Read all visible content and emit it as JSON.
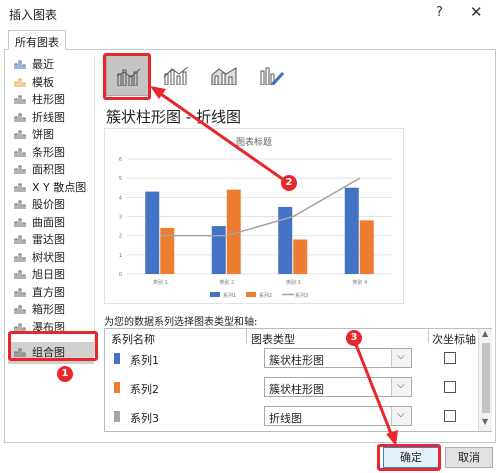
{
  "dialog": {
    "title": "插入图表",
    "help": "?",
    "close": "✕",
    "tab_all": "所有图表"
  },
  "chart_types": [
    {
      "label": "最近",
      "icon": "recent-icon"
    },
    {
      "label": "模板",
      "icon": "template-folder-icon"
    },
    {
      "label": "柱形图",
      "icon": "column-chart-icon"
    },
    {
      "label": "折线图",
      "icon": "line-chart-icon"
    },
    {
      "label": "饼图",
      "icon": "pie-chart-icon"
    },
    {
      "label": "条形图",
      "icon": "bar-chart-icon"
    },
    {
      "label": "面积图",
      "icon": "area-chart-icon"
    },
    {
      "label": "X Y 散点图",
      "icon": "scatter-chart-icon"
    },
    {
      "label": "股价图",
      "icon": "stock-chart-icon"
    },
    {
      "label": "曲面图",
      "icon": "surface-chart-icon"
    },
    {
      "label": "雷达图",
      "icon": "radar-chart-icon"
    },
    {
      "label": "树状图",
      "icon": "treemap-icon"
    },
    {
      "label": "旭日图",
      "icon": "sunburst-icon"
    },
    {
      "label": "直方图",
      "icon": "histogram-icon"
    },
    {
      "label": "箱形图",
      "icon": "box-whisker-icon"
    },
    {
      "label": "瀑布图",
      "icon": "waterfall-icon"
    },
    {
      "label": "组合图",
      "icon": "combo-chart-icon"
    }
  ],
  "selected_type": "组合图",
  "heading": "簇状柱形图 - 折线图",
  "series_caption": "为您的数据系列选择图表类型和轴:",
  "table_headers": {
    "name": "系列名称",
    "type": "图表类型",
    "secondary": "次坐标轴"
  },
  "series_rows": [
    {
      "name": "系列1",
      "type": "簇状柱形图",
      "color": "#4472c4",
      "secondary": false
    },
    {
      "name": "系列2",
      "type": "簇状柱形图",
      "color": "#ed7d31",
      "secondary": false
    },
    {
      "name": "系列3",
      "type": "折线图",
      "color": "#a5a5a5",
      "secondary": false
    }
  ],
  "buttons": {
    "ok": "确定",
    "cancel": "取消"
  },
  "badges": {
    "one": "1",
    "two": "2",
    "three": "3"
  },
  "colors": {
    "accent_red": "#e8262b",
    "series1": "#4472c4",
    "series2": "#ed7d31",
    "series3": "#a5a5a5"
  },
  "chart_data": {
    "type": "bar",
    "title": "图表标题",
    "categories": [
      "类别 1",
      "类别 2",
      "类别 3",
      "类别 4"
    ],
    "ylim": [
      0,
      6
    ],
    "yticks": [
      "0",
      "1",
      "2",
      "3",
      "4",
      "5",
      "6"
    ],
    "series": [
      {
        "name": "系列1",
        "kind": "bar",
        "values": [
          4.3,
          2.5,
          3.5,
          4.5
        ]
      },
      {
        "name": "系列2",
        "kind": "bar",
        "values": [
          2.4,
          4.4,
          1.8,
          2.8
        ]
      },
      {
        "name": "系列3",
        "kind": "line",
        "values": [
          2,
          2,
          3,
          5
        ]
      }
    ],
    "legend": "bottom",
    "grid": true
  }
}
